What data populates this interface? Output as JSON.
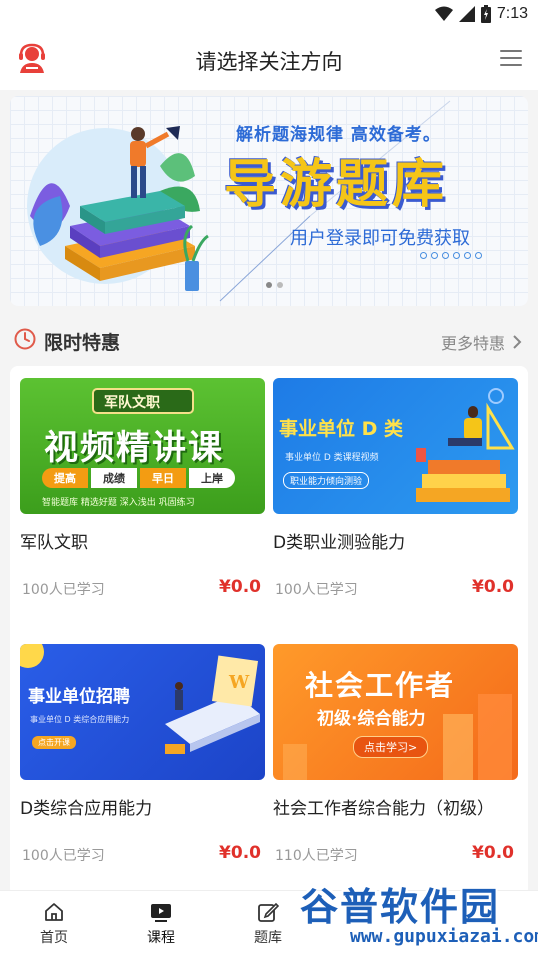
{
  "status_bar": {
    "time": "7:13"
  },
  "header": {
    "title": "请选择关注方向"
  },
  "banner": {
    "line1": "解析题海规律  高效备考。",
    "title": "导游题库",
    "line2": "用户登录即可免费获取"
  },
  "section": {
    "title": "限时特惠",
    "more": "更多特惠"
  },
  "courses": [
    {
      "name": "军队文职",
      "learners": "100人已学习",
      "price": "¥0.0",
      "thumb": {
        "badge": "军队文职",
        "headline": "视频精讲课",
        "tags": [
          "提高",
          "成绩",
          "早日",
          "上岸"
        ],
        "footer": "智能题库  精选好题  深入浅出  巩固练习"
      }
    },
    {
      "name": "D类职业测验能力",
      "learners": "100人已学习",
      "price": "¥0.0",
      "thumb": {
        "headline": "事业单位 D 类",
        "sub": "事业单位  D 类课程视频",
        "pill": "职业能力倾向测验"
      }
    },
    {
      "name": "D类综合应用能力",
      "learners": "100人已学习",
      "price": "¥0.0",
      "thumb": {
        "headline": "事业单位招聘",
        "sub": "事业单位 D 类综合应用能力",
        "pill": "点击开课"
      }
    },
    {
      "name": "社会工作者综合能力（初级）",
      "learners": "110人已学习",
      "price": "¥0.0",
      "thumb": {
        "headline": "社会工作者",
        "sub": "初级·综合能力",
        "pill": "点击学习>"
      }
    }
  ],
  "tabbar": {
    "tabs": [
      {
        "label": "首页",
        "icon": "home-icon"
      },
      {
        "label": "课程",
        "icon": "video-icon"
      },
      {
        "label": "题库",
        "icon": "edit-icon"
      }
    ]
  },
  "watermark": {
    "cn": "谷普软件园",
    "url": "www.gupuxiazai.com"
  },
  "colors": {
    "brand_red": "#e0312b",
    "accent_blue": "#2d6bd6",
    "banner_yellow": "#f5c518"
  }
}
